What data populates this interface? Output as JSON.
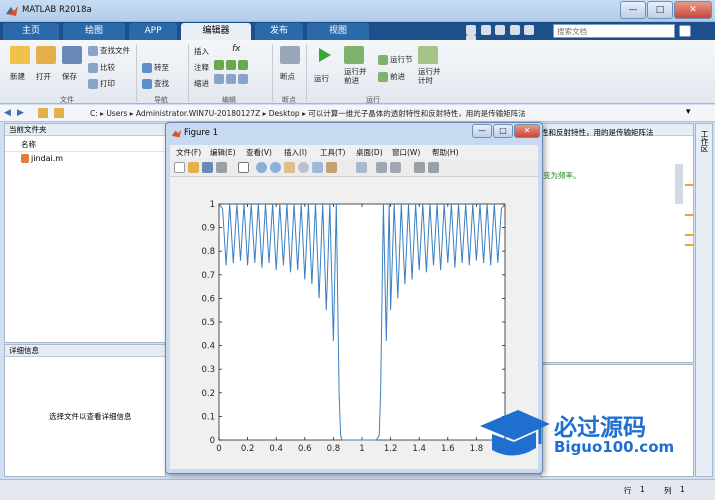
{
  "app": {
    "title": "MATLAB R2018a"
  },
  "window_controls": [
    "—",
    "□",
    "✕"
  ],
  "tabs": [
    {
      "label": "主页"
    },
    {
      "label": "绘图"
    },
    {
      "label": "APP"
    },
    {
      "label": "编辑器"
    },
    {
      "label": "发布"
    },
    {
      "label": "视图"
    }
  ],
  "search": {
    "placeholder": "搜索文档"
  },
  "ribbon": {
    "file": {
      "new": "新建",
      "open": "打开",
      "save": "保存",
      "find_files": "查找文件",
      "compare": "比较",
      "print": "打印",
      "group": "文件"
    },
    "nav": {
      "goto": "转至",
      "find": "查找",
      "group": "导航"
    },
    "edit": {
      "insert": "插入",
      "comment": "注释",
      "indent": "缩进",
      "fx": "fx",
      "group": "编辑"
    },
    "breakpoints": {
      "label": "断点",
      "group": "断点"
    },
    "run": {
      "run": "运行",
      "run_advance": "运行并前进",
      "run_section": "运行节",
      "advance": "前进",
      "run_time": "运行并计时",
      "group": "运行"
    }
  },
  "address": {
    "segments": [
      "C:",
      "Users",
      "Administrator.WIN7U-20180127Z",
      "Desktop",
      "可以计算一维光子晶体的透射特性和反射特性，用的是传输矩阵法"
    ]
  },
  "current_folder": {
    "title": "当前文件夹",
    "col_name": "名称",
    "files": [
      "jindai.m"
    ]
  },
  "details": {
    "title": "详细信息",
    "hint": "选择文件以查看详细信息"
  },
  "editor_snippet": {
    "line1": "性和反射特性，用的是传输矩阵法",
    "line2": "变为频率。"
  },
  "workspace": {
    "label": "工作区"
  },
  "status": {
    "row_label": "行",
    "row": "1",
    "col_label": "列",
    "col": "1"
  },
  "figure": {
    "title": "Figure 1",
    "menu": [
      "文件(F)",
      "编辑(E)",
      "查看(V)",
      "插入(I)",
      "工具(T)",
      "桌面(D)",
      "窗口(W)",
      "帮助(H)"
    ]
  },
  "logo": {
    "cn": "必过源码",
    "en": "Biguo100.com"
  },
  "chart_data": {
    "type": "line",
    "xlim": [
      0,
      2
    ],
    "ylim": [
      0,
      1
    ],
    "xticks": [
      0,
      0.2,
      0.4,
      0.6,
      0.8,
      1,
      1.2,
      1.4,
      1.6,
      1.8,
      2
    ],
    "yticks": [
      0,
      0.1,
      0.2,
      0.3,
      0.4,
      0.5,
      0.6,
      0.7,
      0.8,
      0.9,
      1
    ],
    "grid": false,
    "color": "#3a7fc1",
    "series": [
      {
        "x": [
          0,
          0.025,
          0.05,
          0.075,
          0.1,
          0.125,
          0.15,
          0.175,
          0.2,
          0.225,
          0.25,
          0.275,
          0.3,
          0.325,
          0.35,
          0.375,
          0.4,
          0.425,
          0.45,
          0.475,
          0.5,
          0.525,
          0.55,
          0.575,
          0.6,
          0.625,
          0.65,
          0.675,
          0.7,
          0.725,
          0.75,
          0.775,
          0.8,
          0.81,
          0.82,
          0.83,
          0.84,
          0.85,
          0.86,
          0.87,
          0.88,
          0.9,
          0.95,
          1.0,
          1.05,
          1.1,
          1.12,
          1.13,
          1.14,
          1.15,
          1.16,
          1.17,
          1.18,
          1.19,
          1.2,
          1.225,
          1.25,
          1.275,
          1.3,
          1.325,
          1.35,
          1.375,
          1.4,
          1.425,
          1.45,
          1.475,
          1.5,
          1.525,
          1.55,
          1.575,
          1.6,
          1.625,
          1.65,
          1.675,
          1.7,
          1.725,
          1.75,
          1.775,
          1.8,
          1.825,
          1.85,
          1.875,
          1.9,
          1.925,
          1.95,
          1.975,
          2.0
        ],
        "y": [
          1,
          0.98,
          0.74,
          1,
          0.75,
          1,
          0.76,
          1,
          0.74,
          1,
          0.75,
          1,
          0.73,
          1,
          0.75,
          1,
          0.72,
          1,
          0.74,
          1,
          0.71,
          1,
          0.72,
          1,
          0.68,
          1,
          0.66,
          1,
          0.6,
          1,
          0.55,
          1,
          0.42,
          0.7,
          1,
          0.6,
          0.2,
          0.02,
          0,
          0,
          0,
          0,
          0,
          0,
          0,
          0,
          0.02,
          0.2,
          0.6,
          1,
          0.7,
          0.42,
          0.7,
          1,
          0.55,
          1,
          0.6,
          1,
          0.66,
          1,
          0.68,
          1,
          0.72,
          1,
          0.71,
          1,
          0.74,
          1,
          0.72,
          1,
          0.75,
          1,
          0.73,
          1,
          0.75,
          1,
          0.74,
          1,
          0.76,
          1,
          0.75,
          1,
          0.74,
          1,
          0.75,
          0.98,
          1
        ]
      }
    ]
  }
}
